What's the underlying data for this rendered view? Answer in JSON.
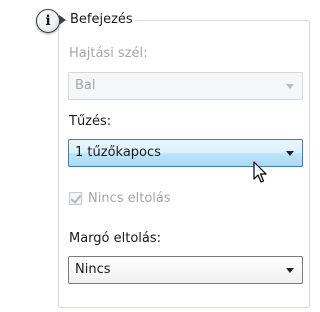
{
  "group": {
    "legend": "Befejezés"
  },
  "binding_edge": {
    "label": "Hajtási szél:",
    "value": "Bal",
    "enabled": false
  },
  "stapling": {
    "label": "Tűzés:",
    "value": "1 tűzőkapocs",
    "enabled": true,
    "state": "hover"
  },
  "no_offset": {
    "label": "Nincs eltolás",
    "checked": true,
    "enabled": false
  },
  "margin_offset": {
    "label": "Margó eltolás:",
    "value": "Nincs",
    "enabled": true
  },
  "icons": {
    "info": "info-icon",
    "cursor": "mouse-pointer-icon",
    "dropdown": "chevron-down-icon"
  },
  "colors": {
    "hover_border": "#3c7fb1",
    "disabled_text": "#a3a6ab"
  }
}
